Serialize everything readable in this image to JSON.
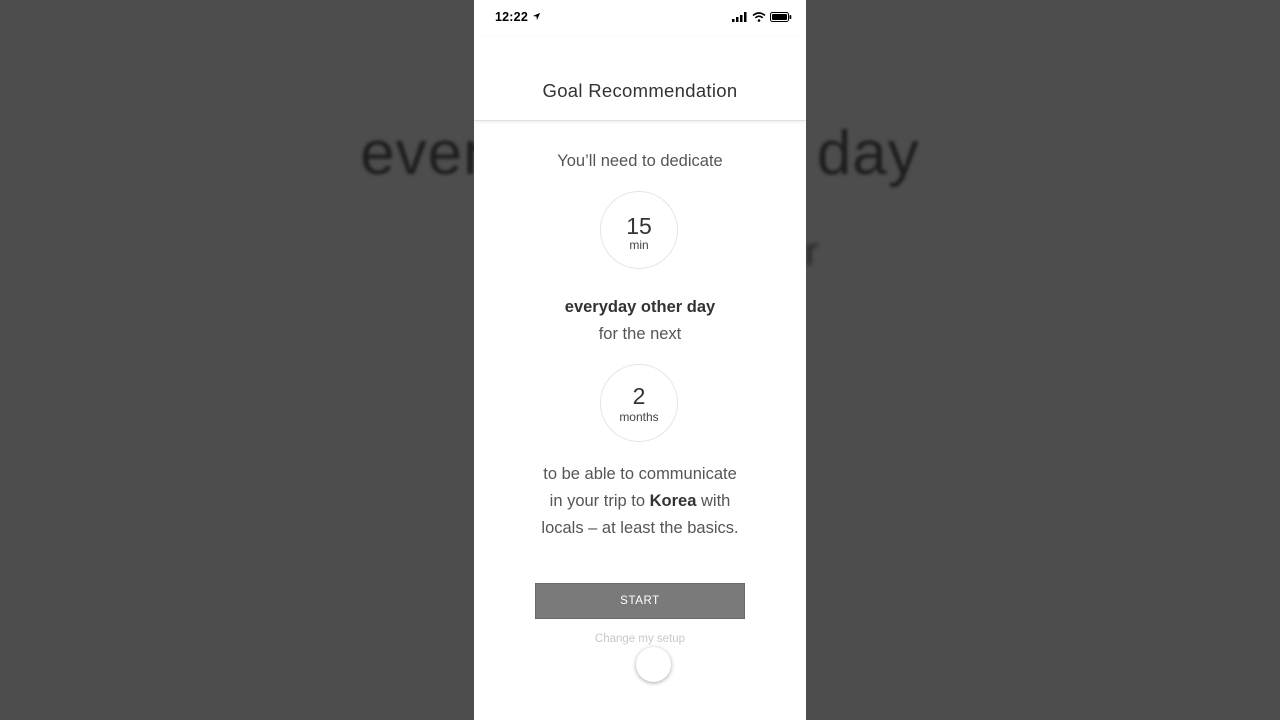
{
  "status_bar": {
    "time": "12:22"
  },
  "header": {
    "title": "Goal Recommendation"
  },
  "background": {
    "big_left": "ever",
    "big_right": "day",
    "line_right_top": "r",
    "line_right_bottom": "."
  },
  "recommendation": {
    "intro": "You’ll need to dedicate",
    "duration": {
      "value": "15",
      "unit": "min"
    },
    "frequency": "everyday other day",
    "period_prefix": "for the next",
    "period": {
      "value": "2",
      "unit": "months"
    },
    "goal_line1": "to be able to communicate",
    "goal_line2_pre": "in your trip to ",
    "goal_destination": "Korea",
    "goal_line2_post": " with",
    "goal_line3": "locals – at least the basics."
  },
  "actions": {
    "start_label": "START",
    "change_setup_label": "Change my setup"
  },
  "colors": {
    "backdrop": "#4d4d4d",
    "button": "#7a7a7a",
    "link": "#c8c8c8"
  }
}
